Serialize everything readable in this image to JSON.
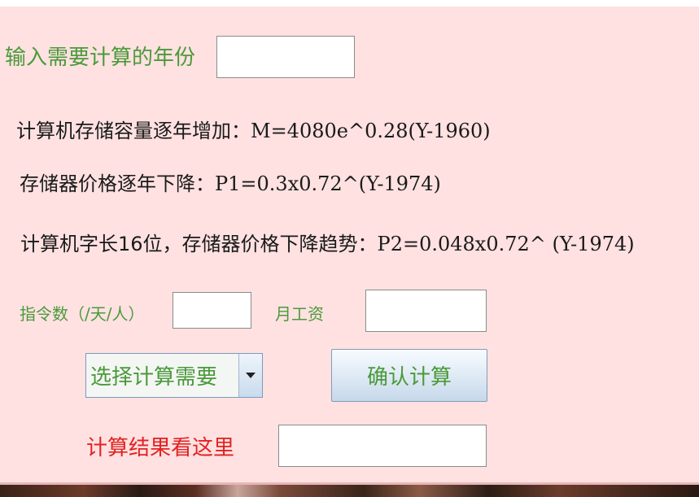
{
  "inputs": {
    "year_label": "输入需要计算的年份",
    "year_value": "",
    "instructions_label": "指令数（/天/人）",
    "instructions_value": "",
    "salary_label": "月工资",
    "salary_value": "",
    "result_label": "计算结果看这里",
    "result_value": ""
  },
  "formulas": [
    {
      "text": "计算机存储容量逐年增加：",
      "equation": "M=4080e^0.28(Y-1960)"
    },
    {
      "text": "存储器价格逐年下降：",
      "equation": "P1=0.3x0.72^(Y-1974)"
    },
    {
      "text": "计算机字长16位，存储器价格下降趋势：",
      "equation": "P2=0.048x0.72^ (Y-1974)"
    }
  ],
  "select": {
    "selected": "选择计算需要"
  },
  "buttons": {
    "confirm": "确认计算"
  },
  "icons": {
    "dropdown": "chevron-down-icon"
  },
  "colors": {
    "background": "#ffe1e1",
    "label_green": "#4a9a3a",
    "result_red": "#e32222",
    "text_black": "#1a1a1a"
  }
}
